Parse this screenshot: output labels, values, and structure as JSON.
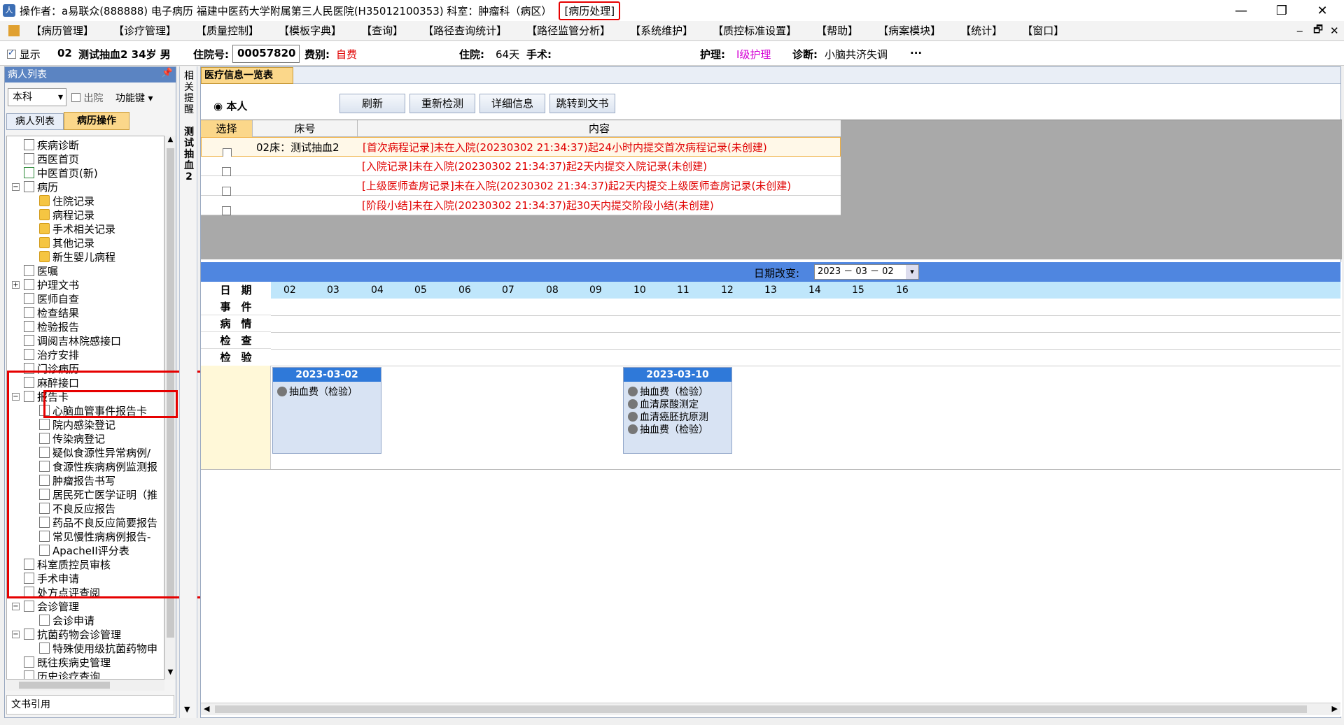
{
  "titlebar": {
    "text": "操作者：a易联众(888888) 电子病历  福建中医药大学附属第三人民医院(H35012100353)  科室：肿瘤科（病区）",
    "highlight": "[病历处理]",
    "min": "—",
    "max": "❐",
    "close": "✕"
  },
  "menu": {
    "items": [
      "【病历管理】",
      "【诊疗管理】",
      "【质量控制】",
      "【模板字典】",
      "【查询】",
      "【路径查询统计】",
      "【路径监管分析】",
      "【系统维护】",
      "【质控标准设置】",
      "【帮助】",
      "【病案模块】",
      "【统计】",
      "【窗口】"
    ],
    "right": [
      "‒",
      "🗗",
      "✕"
    ]
  },
  "patient": {
    "show_label": "显示",
    "bed": "02",
    "name": "测试抽血2 34岁 男",
    "admission_label": "住院号:",
    "admission_no": "00057820",
    "fee_label": "费别:",
    "fee": "自费",
    "stay_label": "住院:",
    "stay": "64天",
    "surgery_label": "手术:",
    "nursing_label": "护理:",
    "nursing": "Ⅰ级护理",
    "diag_label": "诊断:",
    "diag": "小脑共济失调",
    "more": "···"
  },
  "left": {
    "header": "病人列表",
    "dept": "本科",
    "discharge": "出院",
    "func": "功能键",
    "tab1": "病人列表",
    "tab2": "病历操作",
    "footer": "文书引用",
    "tree": [
      "疾病诊断",
      "西医首页",
      "中医首页(新)",
      "病历",
      "住院记录",
      "病程记录",
      "手术相关记录",
      "其他记录",
      "新生婴儿病程",
      "医嘱",
      "护理文书",
      "医师自查",
      "检查结果",
      "检验报告",
      "调阅吉林院感接口",
      "治疗安排",
      "门诊病历",
      "麻醉接口",
      "报告卡",
      "心脑血管事件报告卡",
      "院内感染登记",
      "传染病登记",
      "疑似食源性异常病例/",
      "食源性疾病病例监测报",
      "肿瘤报告书写",
      "居民死亡医学证明（推",
      "不良反应报告",
      "药品不良反应简要报告",
      "常见慢性病病例报告-",
      "ApacheII评分表",
      "科室质控员审核",
      "手术申请",
      "处方点评查阅",
      "会诊管理",
      "会诊申请",
      "抗菌药物会诊管理",
      "特殊使用级抗菌药物申",
      "既往疾病史管理",
      "历史诊疗查询"
    ]
  },
  "vtab": {
    "t1": "相关提醒",
    "t2": "测试抽血2"
  },
  "main": {
    "tab": "医疗信息一览表",
    "radio": "本人",
    "buttons": [
      "刷新",
      "重新检测",
      "详细信息",
      "跳转到文书"
    ],
    "columns": [
      "选择",
      "床号",
      "内容"
    ],
    "rows": [
      {
        "bed": "02床：测试抽血2",
        "content": "[首次病程记录]未在入院(20230302  21:34:37)起24小时内提交首次病程记录(未创建)"
      },
      {
        "bed": "",
        "content": "[入院记录]未在入院(20230302  21:34:37)起2天内提交入院记录(未创建)"
      },
      {
        "bed": "",
        "content": "[上级医师查房记录]未在入院(20230302  21:34:37)起2天内提交上级医师查房记录(未创建)"
      },
      {
        "bed": "",
        "content": "[阶段小结]未在入院(20230302  21:34:37)起30天内提交阶段小结(未创建)"
      }
    ],
    "date_label": "日期改变:",
    "date_value": "2023 － 03 － 02",
    "row_labels": [
      "日　期",
      "事　件",
      "病　情",
      "检　查",
      "检　验"
    ],
    "days": [
      "02",
      "03",
      "04",
      "05",
      "06",
      "07",
      "08",
      "09",
      "10",
      "11",
      "12",
      "13",
      "14",
      "15",
      "16"
    ],
    "events": [
      {
        "date": "2023-03-02",
        "items": [
          "抽血费（检验）"
        ]
      },
      {
        "date": "2023-03-10",
        "items": [
          "抽血费（检验）",
          "血清尿酸测定",
          "血清癌胚抗原测",
          "抽血费（检验）"
        ]
      }
    ]
  }
}
